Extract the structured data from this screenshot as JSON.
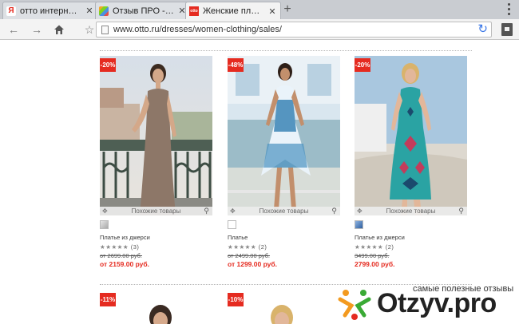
{
  "browser": {
    "tabs": [
      {
        "title": "отто интерн…",
        "favicon": "yandex-icon",
        "active": false
      },
      {
        "title": "Отзыв ПРО -…",
        "favicon": "pinwheel-icon",
        "active": false
      },
      {
        "title": "Женские пл…",
        "favicon": "otto-icon",
        "active": true
      }
    ],
    "close_glyph": "✕",
    "new_tab_glyph": "+",
    "url": "www.otto.ru/dresses/women-clothing/sales/"
  },
  "products": [
    {
      "discount": "-20%",
      "name": "Платье из джерси",
      "rating_stars": "★★★★★",
      "reviews": "(3)",
      "old_price": "от 2699.00 руб.",
      "price": "от 2159.00 руб.",
      "swatch": "#c8c8c8"
    },
    {
      "discount": "-48%",
      "name": "Платье",
      "rating_stars": "★★★★★",
      "reviews": "(2)",
      "old_price": "от 2499.00 руб.",
      "price": "от 1299.00 руб.",
      "swatch": "#ffffff"
    },
    {
      "discount": "-20%",
      "name": "Платье из джерси",
      "rating_stars": "★★★★★",
      "reviews": "(2)",
      "old_price": "3499.00 руб.",
      "price": "2799.00 руб.",
      "swatch": "#4a78b5"
    }
  ],
  "similar_label": "Похожие товары",
  "next_row": [
    {
      "discount": "-11%"
    },
    {
      "discount": "-10%"
    }
  ],
  "watermark": {
    "caption": "самые полезные отзывы",
    "logo": "Otzyv.pro"
  },
  "colors": {
    "accent_red": "#e52b20",
    "link_blue": "#3b78e7",
    "watermark_orange": "#f39a1f",
    "watermark_green": "#3aaa35"
  }
}
